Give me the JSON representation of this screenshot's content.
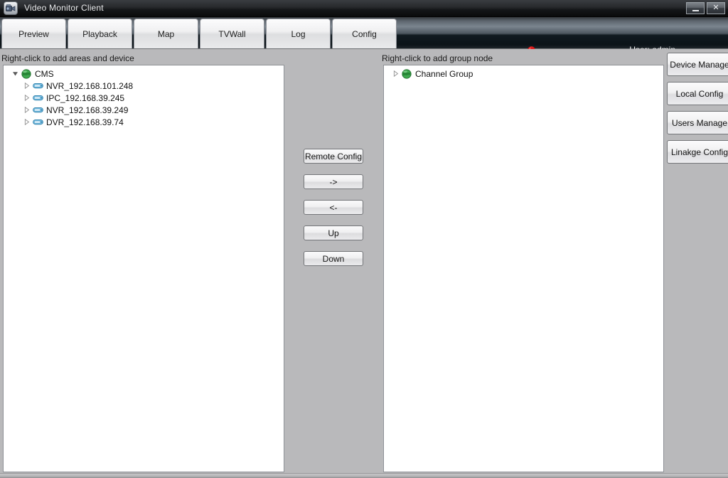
{
  "window": {
    "title": "Video Monitor Client",
    "app_icon": "video-camera-icon",
    "controls": {
      "minimize_label": "",
      "minimize_icon": "minimize-icon",
      "close_label": "✕",
      "close_icon": "close-icon"
    }
  },
  "toolbar": {
    "tabs": [
      {
        "label": "Preview",
        "name": "tab-preview"
      },
      {
        "label": "Playback",
        "name": "tab-playback"
      },
      {
        "label": "Map",
        "name": "tab-map"
      },
      {
        "label": "TVWall",
        "name": "tab-tvwall"
      },
      {
        "label": "Log",
        "name": "tab-log"
      },
      {
        "label": "Config",
        "name": "tab-config"
      }
    ],
    "alarm_icon": "alarm-light-icon",
    "alarm_color": "#e01c1c",
    "user_label": "User: admin"
  },
  "left_panel": {
    "hint": "Right-click to add areas and device",
    "tree": {
      "root": {
        "label": "CMS",
        "icon": "globe-icon",
        "expanded": true
      },
      "children": [
        {
          "label": "NVR_192.168.101.248",
          "icon": "device-icon",
          "expanded": false
        },
        {
          "label": "IPC_192.168.39.245",
          "icon": "device-icon",
          "expanded": false
        },
        {
          "label": "NVR_192.168.39.249",
          "icon": "device-icon",
          "expanded": false
        },
        {
          "label": "DVR_192.168.39.74",
          "icon": "device-icon",
          "expanded": false
        }
      ]
    }
  },
  "middle_buttons": [
    {
      "label": "Remote Config",
      "name": "remote-config-button"
    },
    {
      "label": "->",
      "name": "move-right-button"
    },
    {
      "label": "<-",
      "name": "move-left-button"
    },
    {
      "label": "Up",
      "name": "move-up-button"
    },
    {
      "label": "Down",
      "name": "move-down-button"
    }
  ],
  "right_panel": {
    "hint": "Right-click to add group node",
    "tree": {
      "root": {
        "label": "Channel Group",
        "icon": "globe-icon",
        "expanded": false
      }
    }
  },
  "sidebar": {
    "items": [
      {
        "label": "Device Manage",
        "name": "sidebar-device-manage"
      },
      {
        "label": "Local Config",
        "name": "sidebar-local-config"
      },
      {
        "label": "Users Manage",
        "name": "sidebar-users-manage"
      },
      {
        "label": "Linakge Config",
        "name": "sidebar-linakge-config"
      }
    ]
  },
  "colors": {
    "panel_bg": "#b9b9bb",
    "tree_bg": "#ffffff",
    "titlebar_dark": "#141618",
    "accent_red": "#e01c1c",
    "globe_green": "#2f9b3e"
  }
}
